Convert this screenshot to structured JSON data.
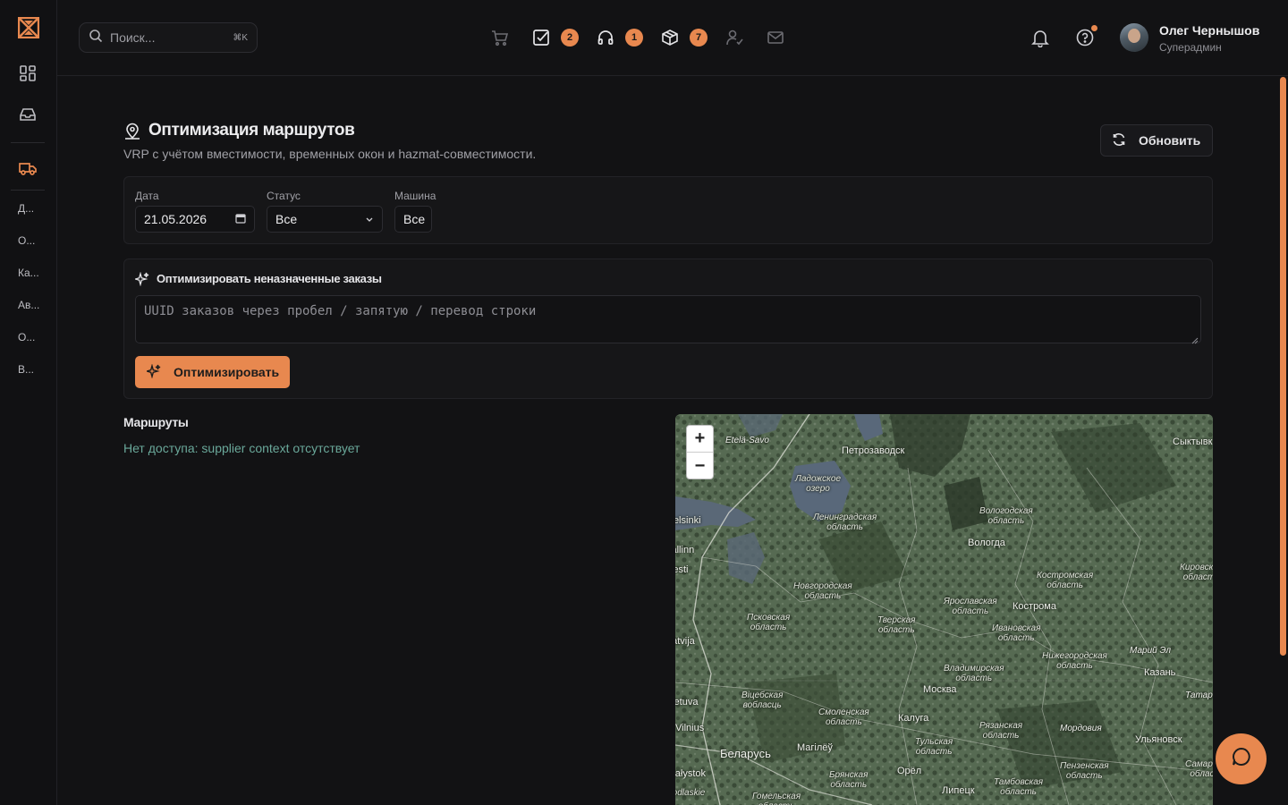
{
  "sidebar": {
    "items": [
      {
        "label": "Д..."
      },
      {
        "label": "О..."
      },
      {
        "label": "Ка..."
      },
      {
        "label": "Ав..."
      },
      {
        "label": "О..."
      },
      {
        "label": "В..."
      }
    ]
  },
  "header": {
    "search": {
      "placeholder": "Поиск...",
      "shortcut": "⌘K"
    },
    "badges": {
      "tasks": "2",
      "support": "1",
      "packages": "7"
    },
    "user": {
      "name": "Олег Чернышов",
      "role": "Суперадмин"
    }
  },
  "page": {
    "title": "Оптимизация маршрутов",
    "subtitle": "VRP с учётом вместимости, временных окон и hazmat-совместимости.",
    "refresh_label": "Обновить"
  },
  "filters": {
    "date_label": "Дата",
    "date_value": "21.05.2026",
    "status_label": "Статус",
    "status_value": "Все",
    "vehicle_label": "Машина",
    "vehicle_value": "Все"
  },
  "optimize": {
    "title": "Оптимизировать неназначенные заказы",
    "placeholder": "UUID заказов через пробел / запятую / перевод строки",
    "button_label": "Оптимизировать"
  },
  "routes": {
    "title": "Маршруты",
    "message": "Нет доступа: supplier context отсутствует"
  },
  "map": {
    "zoom_in": "+",
    "zoom_out": "−",
    "labels": {
      "etela_savo": "Etelä-Savo",
      "petrozavodsk": "Петрозаводск",
      "syktyvkar": "Сыктывкар",
      "ladoga": "Ладожское\nозеро",
      "helsinki": "Helsinki",
      "tallinn": "Tallinn",
      "estonia": "Eesti",
      "len_obl": "Ленинградская\nобласть",
      "vologda_obl": "Вологодская\nобласть",
      "vologda": "Вологда",
      "kirov_obl": "Кировская\nобласть",
      "kostroma_obl": "Костромская\nобласть",
      "novgorod_obl": "Новгородская\nобласть",
      "yaroslavl_obl": "Ярославская\nобласть",
      "kostroma": "Кострома",
      "pskov_obl": "Псковская\nобласть",
      "tver_obl": "Тверская\nобласть",
      "ivanovo_obl": "Ивановская\nобласть",
      "mari_el": "Марий Эл",
      "latvia": "Latvija",
      "nizhny_obl": "Нижегородская\nобласть",
      "vladimir_obl": "Владимирская\nобласть",
      "kazan": "Казань",
      "moscow": "Москва",
      "tatarstan": "Татарстан",
      "vitebsk_obl": "Віцебская\nвобласць",
      "smolensk_obl": "Смоленская\nобласть",
      "kaluga": "Калуга",
      "ryazan_obl": "Рязанская\nобласть",
      "mordovia": "Мордовия",
      "lithuania": "Lietuva",
      "vilnius": "Vilnius",
      "ulyanovsk": "Ульяновск",
      "mogilev": "Магілёў",
      "tula_obl": "Тульская\nобласть",
      "belarus": "Беларусь",
      "penza_obl": "Пензенская\nобласть",
      "samara_obl": "Самарская\nобласть",
      "oryol": "Орёл",
      "bryansk_obl": "Брянская\nобласть",
      "bialystok": "Białystok",
      "tambov_obl": "Тамбовская\nобласть",
      "lipetsk": "Липецк",
      "gomel_obl": "Гомельская\nобласть",
      "podlaskie": "Podlaskie"
    }
  },
  "colors": {
    "accent": "#e8884f",
    "background": "#121214",
    "link": "#6aa89a"
  }
}
